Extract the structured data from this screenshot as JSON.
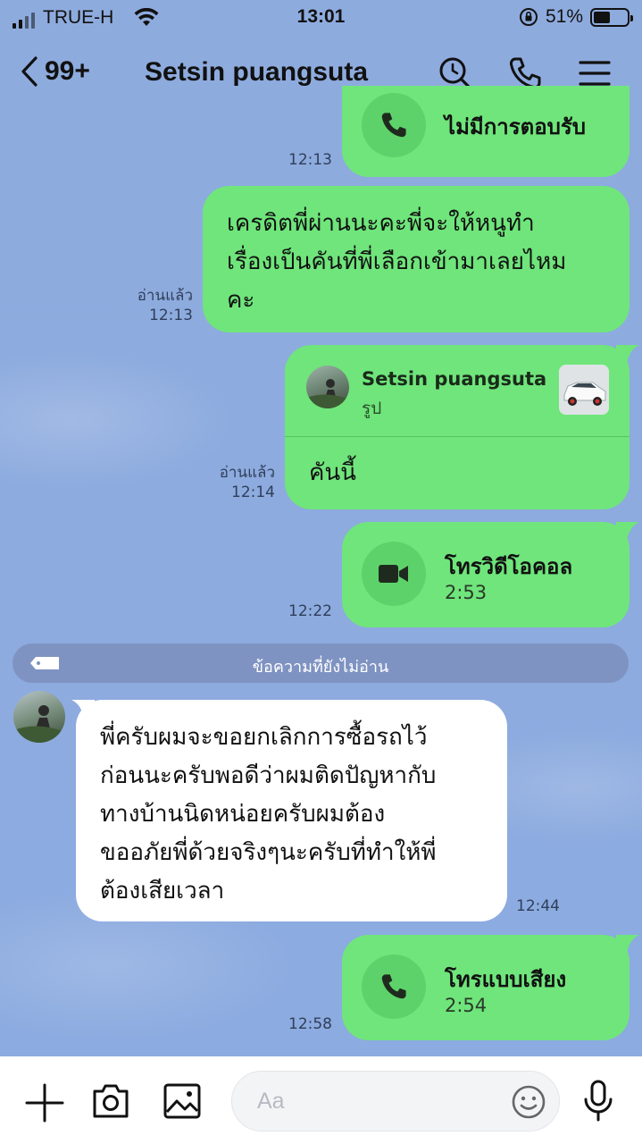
{
  "status_bar": {
    "carrier": "TRUE-H",
    "time": "13:01",
    "battery": "51%"
  },
  "header": {
    "unread_count": "99+",
    "contact_name": "Setsin puangsuta",
    "icons": [
      "back-chevron-icon",
      "search-icon",
      "phone-icon",
      "menu-icon"
    ]
  },
  "messages": [
    {
      "type": "call",
      "side": "sent",
      "title": "ไม่มีการตอบรับ",
      "time": "12:13",
      "icon": "phone-icon"
    },
    {
      "type": "text",
      "side": "sent",
      "lines": [
        "เครดิตพี่ผ่านนะคะพี่จะให้หนูทำ",
        "เรื่องเป็นคันที่พี่เลือกเข้ามาเลยไหม",
        "คะ"
      ],
      "read": "อ่านแล้ว",
      "time": "12:13"
    },
    {
      "type": "reply",
      "side": "sent",
      "quoted_name": "Setsin puangsuta",
      "quoted_kind": "รูป",
      "text": "คันนี้",
      "read": "อ่านแล้ว",
      "time": "12:14"
    },
    {
      "type": "call",
      "side": "sent",
      "title": "โทรวิดีโอคอล",
      "duration": "2:53",
      "time": "12:22",
      "icon": "video-camera-icon"
    },
    {
      "type": "text",
      "side": "received",
      "lines": [
        "พี่ครับผมจะขอยกเลิกการซื้อรถไว้",
        "ก่อนนะครับพอดีว่าผมติดปัญหากับ",
        "ทางบ้านนิดหน่อยครับผมต้อง",
        "ขออภัยพี่ด้วยจริงๆนะครับที่ทำให้พี่",
        "ต้องเสียเวลา"
      ],
      "time": "12:44"
    },
    {
      "type": "call",
      "side": "sent",
      "title": "โทรแบบเสียง",
      "duration": "2:54",
      "time": "12:58",
      "icon": "phone-icon"
    }
  ],
  "unread_divider": "ข้อความที่ยังไม่อ่าน",
  "composer": {
    "placeholder": "Aa",
    "icons": [
      "plus-icon",
      "camera-icon",
      "image-icon",
      "emoji-icon",
      "microphone-icon"
    ]
  },
  "colors": {
    "sent_bubble": "#6fe57b",
    "received_bubble": "#ffffff",
    "chat_background": "#8cabe0"
  }
}
